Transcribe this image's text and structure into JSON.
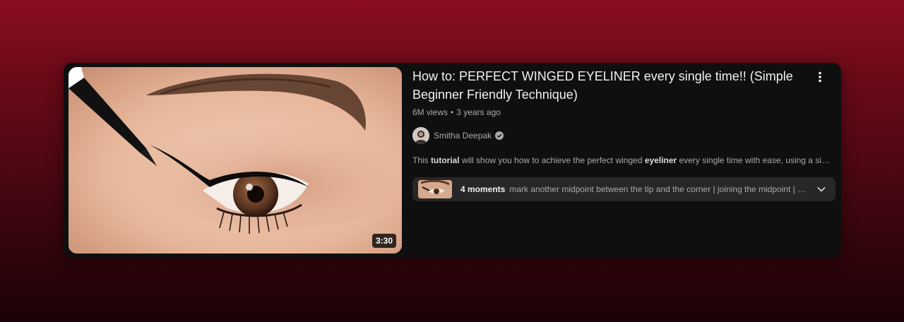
{
  "video": {
    "title": "How to: PERFECT WINGED EYELINER every single time!! (Simple Beginner Friendly Technique)",
    "views": "6M views",
    "separator": "•",
    "age": "3 years ago",
    "duration": "3:30",
    "thumbnail_icon": "eyeliner-thumbnail-image"
  },
  "channel": {
    "name": "Smitha Deepak",
    "verified_icon": "verified-check-icon",
    "avatar_icon": "channel-avatar"
  },
  "description": {
    "part1": "This ",
    "bold1": "tutorial",
    "part2": " will show you how to achieve the perfect winged ",
    "bold2": "eyeliner",
    "part3": " every single time with ease, using a simple begi..."
  },
  "moments": {
    "count_label": "4 moments",
    "text": "mark another midpoint between the tip and the corner | joining the midpoint | apply ...",
    "expand_icon": "chevron-down-icon"
  },
  "menu": {
    "more_icon": "more-vert-icon"
  },
  "colors": {
    "background_top": "#8a0d1f",
    "card": "#0f0f0f",
    "moments_bg": "#272727",
    "primary_text": "#f1f1f1",
    "secondary_text": "#aaaaaa"
  }
}
